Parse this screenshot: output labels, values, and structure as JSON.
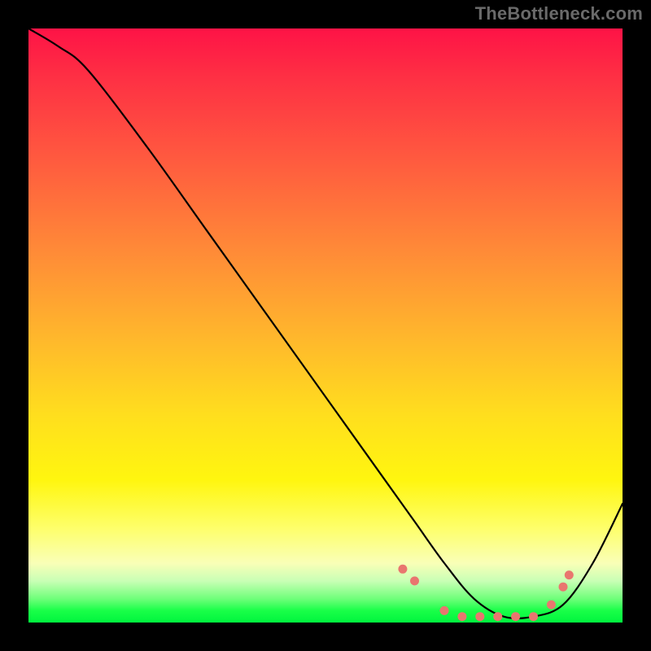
{
  "attribution": "TheBottleneck.com",
  "chart_data": {
    "type": "line",
    "title": "",
    "xlabel": "",
    "ylabel": "",
    "xlim": [
      0,
      100
    ],
    "ylim": [
      0,
      100
    ],
    "series": [
      {
        "name": "bottleneck-curve",
        "x": [
          0,
          5,
          10,
          20,
          30,
          40,
          50,
          60,
          65,
          70,
          75,
          80,
          85,
          90,
          95,
          100
        ],
        "y": [
          100,
          97,
          93,
          80,
          66,
          52,
          38,
          24,
          17,
          10,
          4,
          1,
          1,
          3,
          10,
          20
        ]
      }
    ],
    "markers": {
      "name": "highlight-dots",
      "x": [
        63,
        65,
        70,
        73,
        76,
        79,
        82,
        85,
        88,
        90,
        91
      ],
      "y": [
        9,
        7,
        2,
        1,
        1,
        1,
        1,
        1,
        3,
        6,
        8
      ]
    },
    "gradient_stops": [
      {
        "pos": 0.0,
        "color": "#fe1346"
      },
      {
        "pos": 0.22,
        "color": "#ff5a3f"
      },
      {
        "pos": 0.52,
        "color": "#ffb72c"
      },
      {
        "pos": 0.76,
        "color": "#fff60f"
      },
      {
        "pos": 0.93,
        "color": "#c9ffb5"
      },
      {
        "pos": 1.0,
        "color": "#00f53e"
      }
    ]
  }
}
